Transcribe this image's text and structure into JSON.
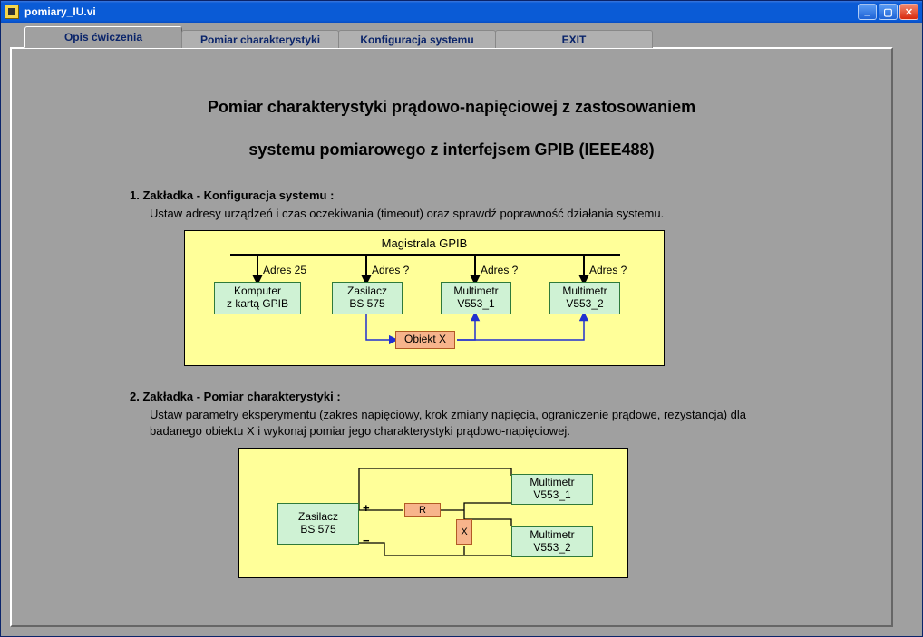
{
  "window": {
    "title": "pomiary_IU.vi"
  },
  "tabs": [
    {
      "label": "Opis ćwiczenia"
    },
    {
      "label": "Pomiar charakterystyki"
    },
    {
      "label": "Konfiguracja systemu"
    },
    {
      "label": "EXIT"
    }
  ],
  "title_line1": "Pomiar charakterystyki prądowo-napięciowej z zastosowaniem",
  "title_line2": "systemu pomiarowego z interfejsem GPIB (IEEE488)",
  "section1": {
    "heading": "1. Zakładka - Konfiguracja systemu :",
    "text": "Ustaw adresy urządzeń i czas oczekiwania (timeout) oraz sprawdź poprawność działania systemu."
  },
  "diagram1": {
    "bus_title": "Magistrala GPIB",
    "addr0": "Adres 25",
    "addr1": "Adres ?",
    "addr2": "Adres ?",
    "addr3": "Adres ?",
    "box0a": "Komputer",
    "box0b": "z kartą GPIB",
    "box1a": "Zasilacz",
    "box1b": "BS 575",
    "box2a": "Multimetr",
    "box2b": "V553_1",
    "box3a": "Multimetr",
    "box3b": "V553_2",
    "obj": "Obiekt X"
  },
  "section2": {
    "heading": "2. Zakładka - Pomiar charakterystyki :",
    "text": "Ustaw parametry eksperymentu (zakres napięciowy, krok zmiany napięcia, ograniczenie prądowe,  rezystancja) dla badanego obiektu X  i wykonaj pomiar jego charakterystyki prądowo-napięciowej."
  },
  "diagram2": {
    "psu_a": "Zasilacz",
    "psu_b": "BS 575",
    "m1a": "Multimetr",
    "m1b": "V553_1",
    "m2a": "Multimetr",
    "m2b": "V553_2",
    "r": "R",
    "x": "X",
    "plus": "+",
    "minus": "−"
  }
}
